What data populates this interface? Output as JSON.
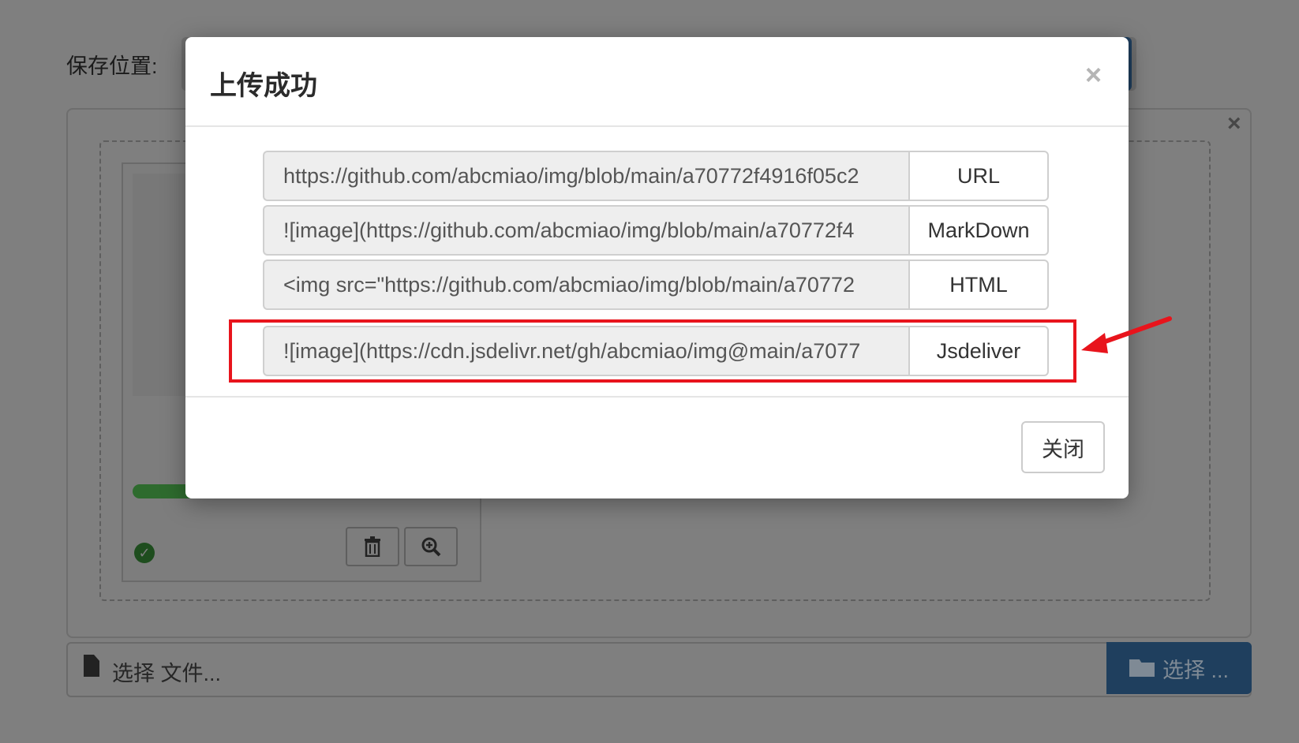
{
  "background": {
    "save_location_label": "保存位置:",
    "file_placeholder": "选择 文件...",
    "file_button_label": "选择 ...",
    "upload_progress_percent": 100
  },
  "modal": {
    "title": "上传成功",
    "close_symbol": "×",
    "rows": [
      {
        "value": "https://github.com/abcmiao/img/blob/main/a70772f4916f05c2",
        "button": "URL"
      },
      {
        "value": "![image](https://github.com/abcmiao/img/blob/main/a70772f4",
        "button": "MarkDown"
      },
      {
        "value": "<img src=\"https://github.com/abcmiao/img/blob/main/a70772",
        "button": "HTML"
      },
      {
        "value": "![image](https://cdn.jsdelivr.net/gh/abcmiao/img@main/a7077",
        "button": "Jsdeliver"
      }
    ],
    "footer_close_label": "关闭"
  },
  "annotation": {
    "highlight_color": "#e8141c",
    "arrow_icon": "red-arrow-icon"
  },
  "colors": {
    "overlay": "#7f7f7f",
    "primary_button": "#1f3f5e",
    "success": "#2e6b2e"
  }
}
